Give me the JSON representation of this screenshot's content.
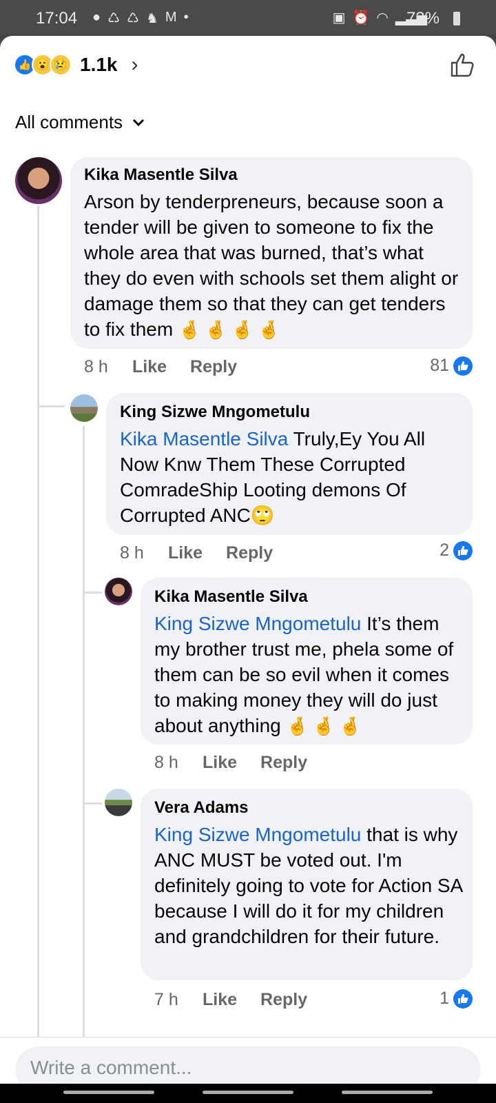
{
  "status_bar": {
    "time": "17:04",
    "battery": "72%"
  },
  "reactions": {
    "count": "1.1k"
  },
  "sort": {
    "label": "All comments"
  },
  "comments": [
    {
      "author": "Kika Masentle Silva",
      "text": "Arson by tenderpreneurs, because soon a tender will be given to someone to fix the whole area that was burned, that’s what they do even with schools set them alight or damage them so that they can get tenders to fix them",
      "emoji": "🤞🤞🤞🤞",
      "time": "8 h",
      "like": "Like",
      "reply": "Reply",
      "likes": "81"
    },
    {
      "author": "King Sizwe Mngometulu",
      "mention": "Kika Masentle Silva",
      "text": " Truly,Ey You All Now Knw Them These Corrupted ComradeShip Looting demons Of Corrupted ANC",
      "emoji": "🙄",
      "time": "8 h",
      "like": "Like",
      "reply": "Reply",
      "likes": "2"
    },
    {
      "author": "Kika Masentle Silva",
      "mention": "King Sizwe Mngometulu",
      "text": " It’s them my brother trust me, phela some of them can be so evil when it comes to making money they will do just about anything",
      "emoji": "🤞🤞🤞",
      "time": "8 h",
      "like": "Like",
      "reply": "Reply"
    },
    {
      "author": "Vera Adams",
      "mention": "King Sizwe Mngometulu",
      "text": " that is why ANC MUST be voted out. I'm definitely going to vote for Action SA because I will do it for my children and grandchildren for their future.",
      "time": "7 h",
      "like": "Like",
      "reply": "Reply",
      "likes": "1"
    }
  ],
  "composer": {
    "placeholder": "Write a comment..."
  }
}
